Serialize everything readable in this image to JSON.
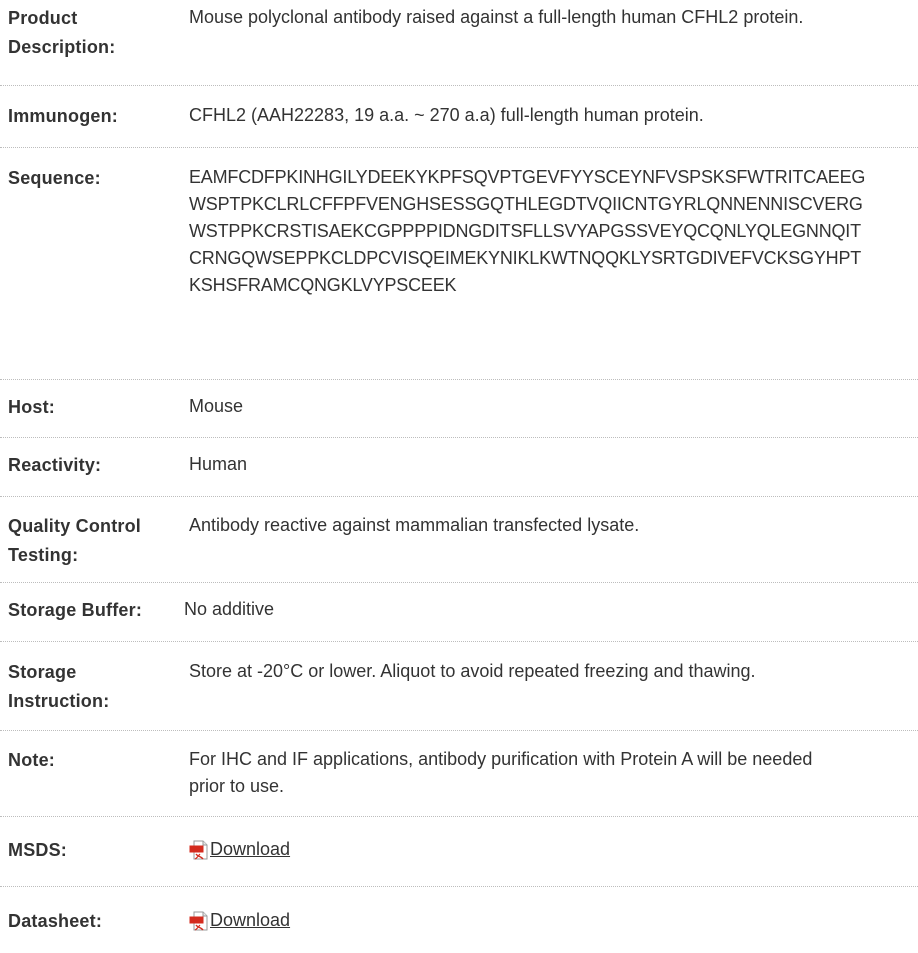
{
  "rows": [
    {
      "label": "Product Description:",
      "value": "Mouse polyclonal antibody raised against a full-length human CFHL2 protein."
    },
    {
      "label": "Immunogen:",
      "value": "CFHL2 (AAH22283, 19 a.a. ~ 270 a.a) full-length human protein."
    },
    {
      "label": "Sequence:",
      "value": "EAMFCDFPKINHGILYDEEKYKPFSQVPTGEVFYYSCEYNFVSPSKSFWTRITCAEEGWSPTPKCLRLCFFPFVENGHSESSGQTHLEGDTVQIICNTGYRLQNNENNISCVERGWSTPPKCRSTISAEKCGPPPPIDNGDITSFLLSVYAPGSSVEYQCQNLYQLEGNNQITCRNGQWSEPPKCLDPCVISQEIMEKYNIKLKWTNQQKLYSRTGDIVEFVCKSGYHPTKSHSFRAMCQNGKLVYPSCEEK"
    },
    {
      "label": "Host:",
      "value": "Mouse"
    },
    {
      "label": "Reactivity:",
      "value": "Human"
    },
    {
      "label": "Quality Control Testing:",
      "value": "Antibody reactive against mammalian transfected lysate."
    },
    {
      "label": "Storage Buffer:",
      "value": "No additive"
    },
    {
      "label": "Storage Instruction:",
      "value": "Store at -20°C or lower. Aliquot to avoid repeated freezing and thawing."
    },
    {
      "label": "Note:",
      "value": "For IHC and IF applications, antibody purification with Protein A will be needed prior to use."
    },
    {
      "label": "MSDS:",
      "link_text": "Download",
      "icon": "pdf-icon"
    },
    {
      "label": "Datasheet:",
      "link_text": "Download",
      "icon": "pdf-icon"
    }
  ],
  "colors": {
    "text": "#333333",
    "divider": "#bdbdbd",
    "pdf_red": "#d42b1e"
  }
}
